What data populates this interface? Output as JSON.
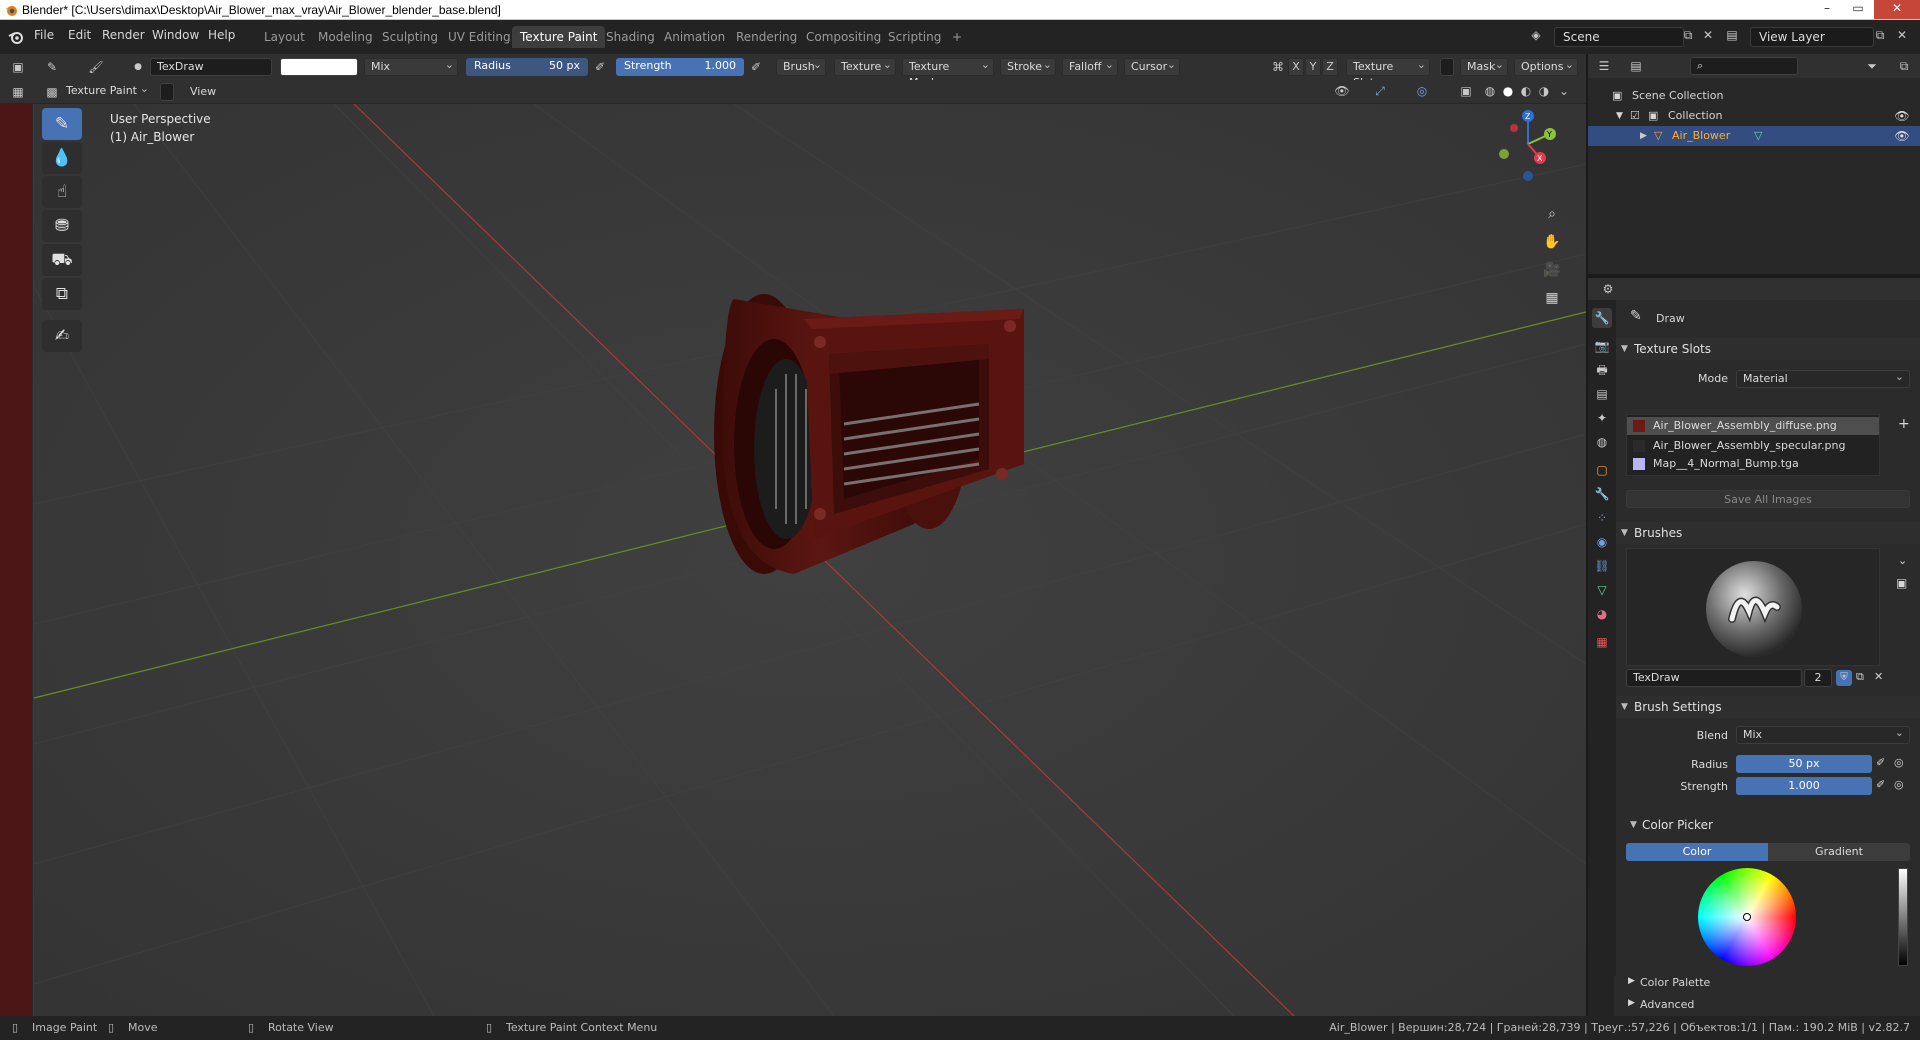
{
  "window": {
    "title": "Blender* [C:\\Users\\dimax\\Desktop\\Air_Blower_max_vray\\Air_Blower_blender_base.blend]",
    "min_label": "–",
    "max_label": "▭",
    "close_label": "✕"
  },
  "menu": {
    "items": [
      "File",
      "Edit",
      "Render",
      "Window",
      "Help"
    ]
  },
  "workspaces": {
    "tabs": [
      "Layout",
      "Modeling",
      "Sculpting",
      "UV Editing",
      "Texture Paint",
      "Shading",
      "Animation",
      "Rendering",
      "Compositing",
      "Scripting"
    ],
    "active": "Texture Paint",
    "add_label": "+"
  },
  "scene": {
    "name": "Scene",
    "view_layer": "View Layer"
  },
  "tool_header": {
    "brush_name": "TexDraw",
    "blend": "Mix",
    "radius_label": "Radius",
    "radius_value": "50 px",
    "strength_label": "Strength",
    "strength_value": "1.000",
    "menus": [
      "Brush",
      "Texture",
      "Texture Mask",
      "Stroke",
      "Falloff",
      "Cursor"
    ],
    "axes": [
      "X",
      "Y",
      "Z"
    ],
    "texture_slots": "Texture Slots",
    "mask": "Mask",
    "options": "Options"
  },
  "viewport_header": {
    "mode": "Texture Paint",
    "view": "View"
  },
  "viewport": {
    "perspective": "User Perspective",
    "object_label": "(1) Air_Blower",
    "gizmo_axes": [
      "X",
      "Y",
      "Z"
    ]
  },
  "outliner": {
    "scene_collection": "Scene Collection",
    "collection": "Collection",
    "object": "Air_Blower"
  },
  "properties": {
    "tool_name": "Draw",
    "texture_slots": {
      "title": "Texture Slots",
      "mode_label": "Mode",
      "mode_value": "Material",
      "slots": [
        {
          "name": "Air_Blower_Assembly_diffuse.png",
          "color": "#6b1a14"
        },
        {
          "name": "Air_Blower_Assembly_specular.png",
          "color": "#2a2a2a"
        },
        {
          "name": "Map__4_Normal_Bump.tga",
          "color": "#b9b5f2"
        }
      ],
      "save_all": "Save All Images"
    },
    "brushes": {
      "title": "Brushes",
      "brush_name": "TexDraw",
      "users": "2"
    },
    "brush_settings": {
      "title": "Brush Settings",
      "blend_label": "Blend",
      "blend_value": "Mix",
      "radius_label": "Radius",
      "radius_value": "50 px",
      "strength_label": "Strength",
      "strength_value": "1.000"
    },
    "color_picker": {
      "title": "Color Picker",
      "tabs": [
        "Color",
        "Gradient"
      ],
      "active_tab": "Color",
      "current_color": "#ffffff"
    },
    "color_palette": "Color Palette",
    "advanced": "Advanced"
  },
  "statusbar": {
    "image_paint": "Image Paint",
    "move": "Move",
    "rotate": "Rotate View",
    "context_menu": "Texture Paint Context Menu",
    "stats": "Air_Blower | Вершин:28,724 | Граней:28,739 | Треуг.:57,226 | Объектов:1/1 | Пам.: 190.2 MiB | v2.82.7"
  },
  "colors": {
    "accent": "#4772b3",
    "selected_row": "#334d80",
    "object_highlight": "#ffaf29",
    "blower_red": "#5a1410"
  }
}
